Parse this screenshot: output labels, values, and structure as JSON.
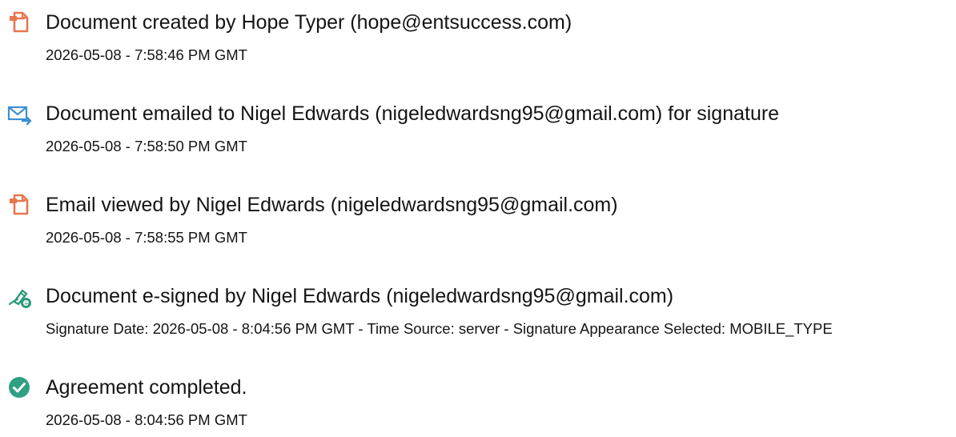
{
  "colors": {
    "doc_icon": "#e8764f",
    "mail_icon": "#3f8fd2",
    "sign_icon": "#2e9a7c",
    "check_icon": "#2fa082",
    "text": "#141414"
  },
  "events": [
    {
      "icon": "document-icon",
      "title": "Document created by Hope Typer (hope@entsuccess.com)",
      "meta": "2026-05-08 - 7:58:46 PM GMT"
    },
    {
      "icon": "email-sent-icon",
      "title": "Document emailed to Nigel Edwards (nigeledwardsng95@gmail.com) for signature",
      "meta": "2026-05-08 - 7:58:50 PM GMT"
    },
    {
      "icon": "document-icon",
      "title": "Email viewed by Nigel Edwards (nigeledwardsng95@gmail.com)",
      "meta": "2026-05-08 - 7:58:55 PM GMT"
    },
    {
      "icon": "e-sign-pen-icon",
      "title": "Document e-signed by Nigel Edwards (nigeledwardsng95@gmail.com)",
      "meta": "Signature Date: 2026-05-08 - 8:04:56 PM GMT - Time Source: server - Signature Appearance Selected: MOBILE_TYPE"
    },
    {
      "icon": "check-circle-icon",
      "title": "Agreement completed.",
      "meta": "2026-05-08 - 8:04:56 PM GMT"
    }
  ]
}
